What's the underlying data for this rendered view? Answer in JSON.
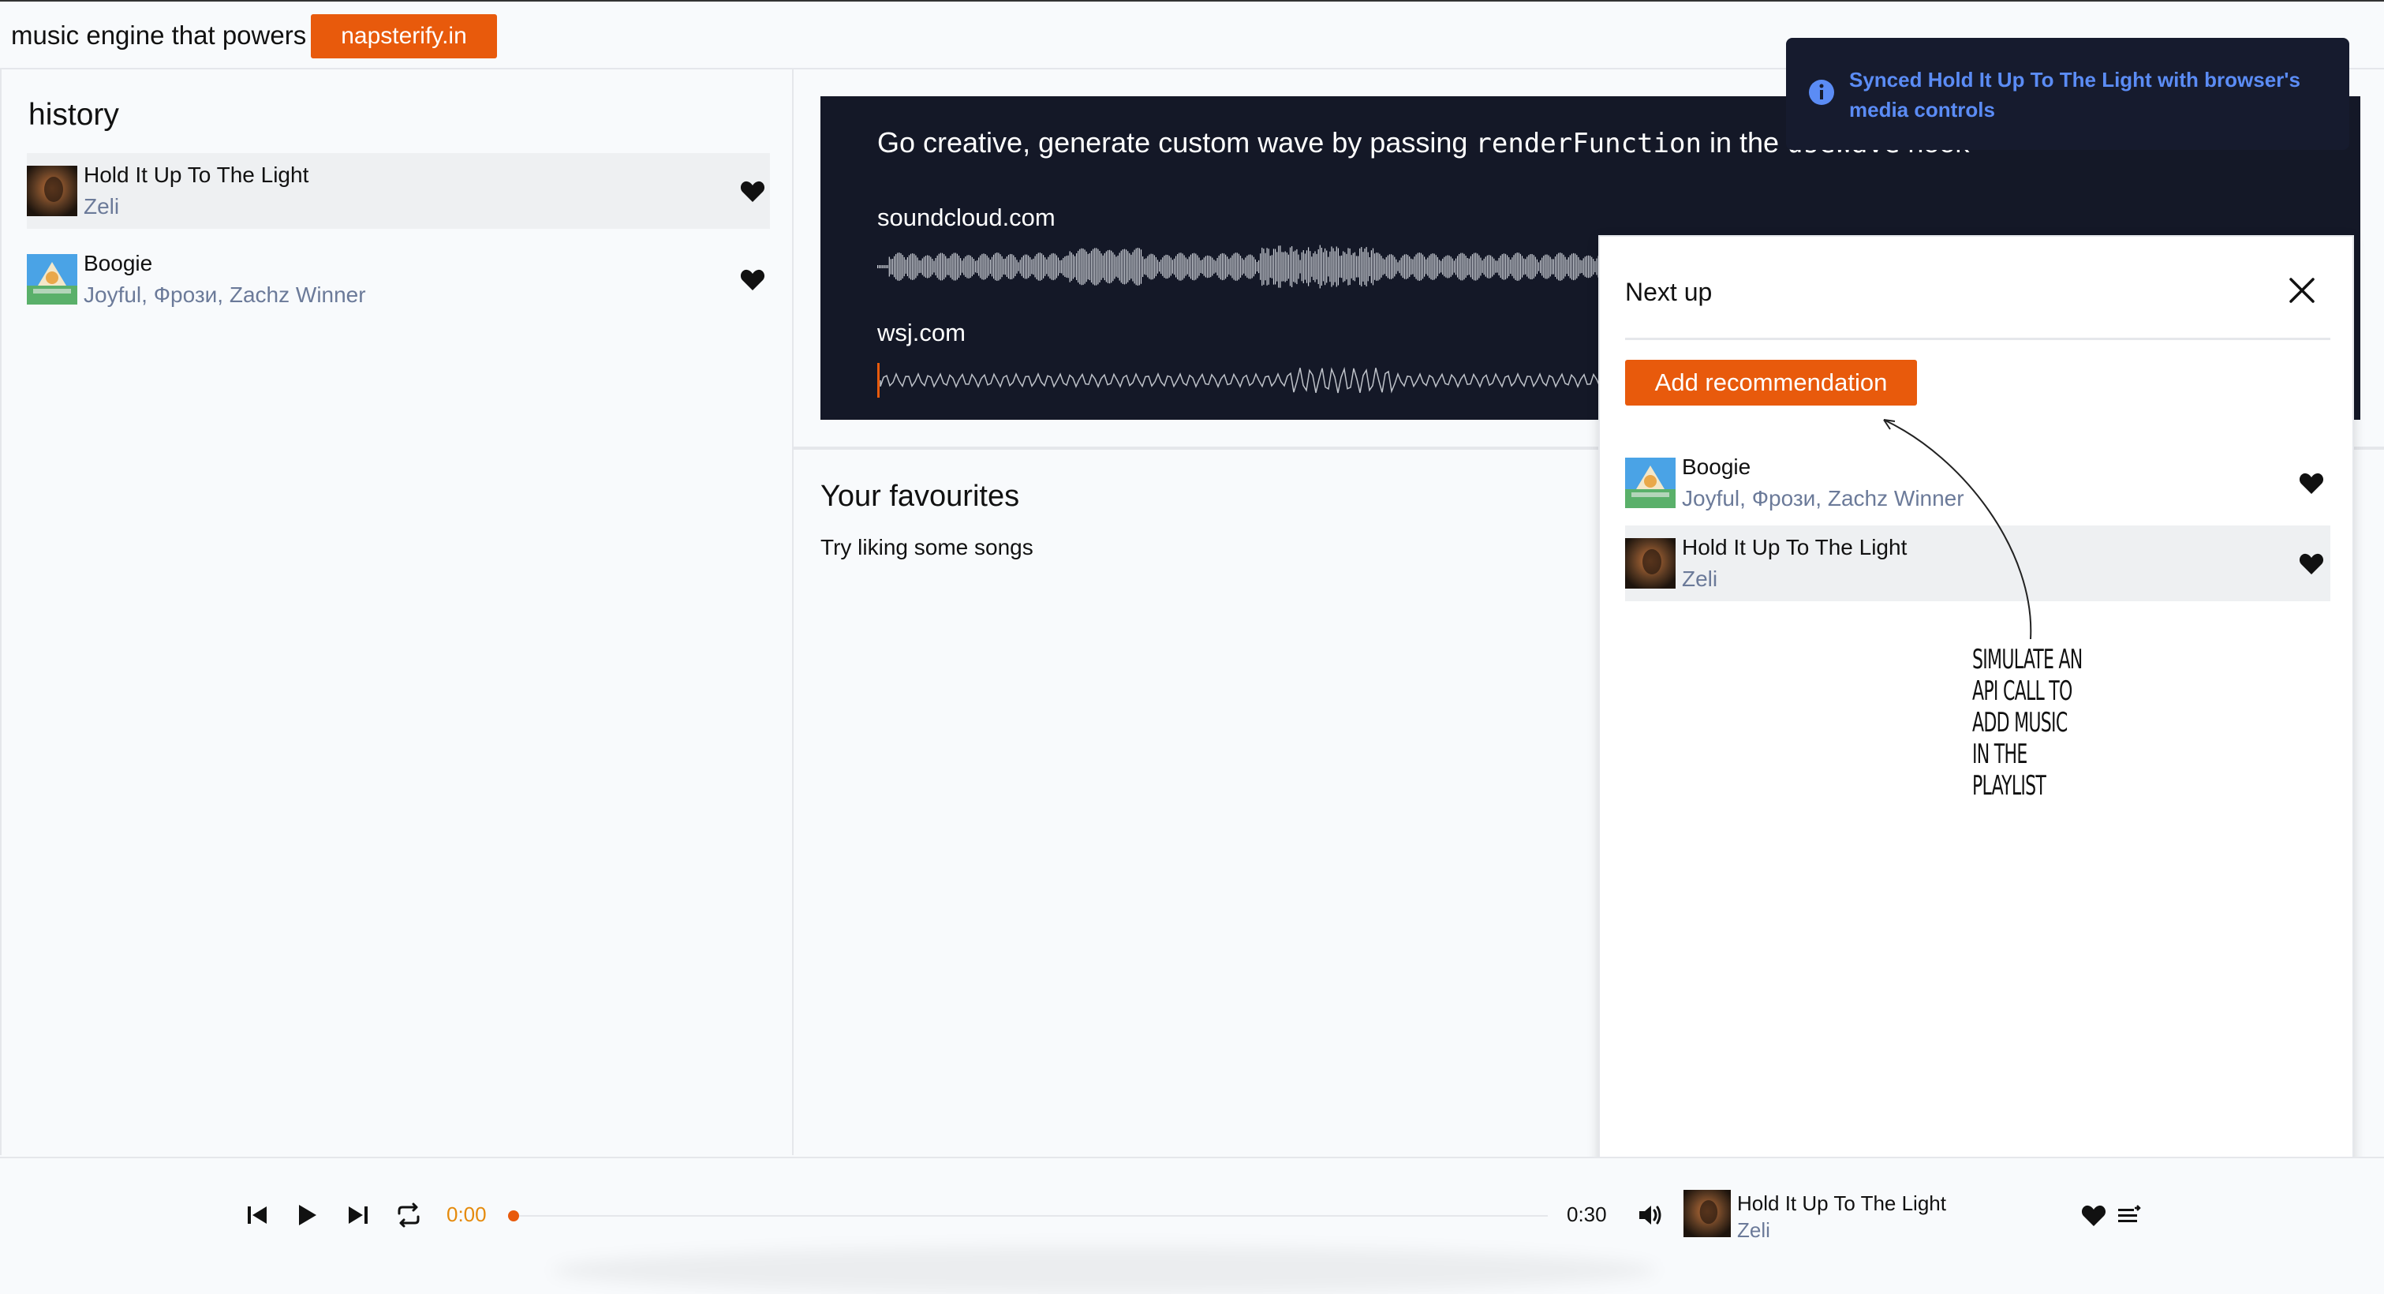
{
  "topbar": {
    "tagline": "music engine that powers",
    "brand_button": "napsterify.in"
  },
  "sidebar": {
    "heading": "history",
    "items": [
      {
        "title": "Hold It Up To The Light",
        "artist": "Zeli",
        "active": true
      },
      {
        "title": "Boogie",
        "artist": "Joyful, Фрози, Zachz Winner",
        "active": false
      }
    ]
  },
  "wave_card": {
    "headline_prefix": "Go creative, generate custom wave by passing ",
    "headline_code": "renderFunction",
    "headline_suffix": " in the ",
    "headline_code2": "useWave",
    "headline_end": " hook",
    "label_1": "soundcloud.com",
    "label_2": "wsj.com"
  },
  "favourites": {
    "title": "Your favourites",
    "empty_text": "Try liking some songs"
  },
  "toast": {
    "message": "Synced Hold It Up To The Light with browser's media controls"
  },
  "next_up": {
    "title": "Next up",
    "add_button": "Add recommendation",
    "items": [
      {
        "title": "Boogie",
        "artist": "Joyful, Фрози, Zachz Winner",
        "active": false
      },
      {
        "title": "Hold It Up To The Light",
        "artist": "Zeli",
        "active": true
      }
    ],
    "annotation": "SIMULATE AN API CALL TO ADD MUSIC IN THE PLAYLIST"
  },
  "player": {
    "current_time": "0:00",
    "total_time": "0:30",
    "progress": 0,
    "now_playing_title": "Hold It Up To The Light",
    "now_playing_artist": "Zeli"
  },
  "colors": {
    "accent": "#e85a0c",
    "wave_bg": "#141827",
    "toast_text": "#5b8cf5",
    "muted_text": "#6b7a99"
  }
}
